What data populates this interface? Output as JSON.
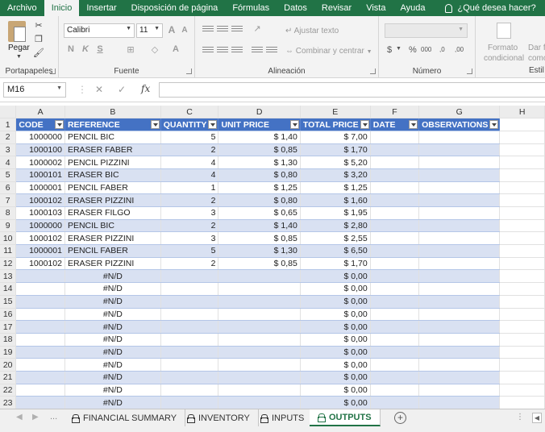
{
  "menu": {
    "items": [
      {
        "label": "Archivo",
        "active": false
      },
      {
        "label": "Inicio",
        "active": true
      },
      {
        "label": "Insertar",
        "active": false
      },
      {
        "label": "Disposición de página",
        "active": false
      },
      {
        "label": "Fórmulas",
        "active": false
      },
      {
        "label": "Datos",
        "active": false
      },
      {
        "label": "Revisar",
        "active": false
      },
      {
        "label": "Vista",
        "active": false
      },
      {
        "label": "Ayuda",
        "active": false
      }
    ],
    "tell_me": "¿Qué desea hacer?"
  },
  "ribbon": {
    "clipboard": {
      "paste_label": "Pegar",
      "group_label": "Portapapeles"
    },
    "font": {
      "font_name": "Calibri",
      "font_size": "11",
      "group_label": "Fuente",
      "bold": "N",
      "italic": "K",
      "underline": "S",
      "grow": "A",
      "shrink": "A",
      "font_color": "A"
    },
    "alignment": {
      "wrap_text": "Ajustar texto",
      "merge_center": "Combinar y centrar",
      "group_label": "Alineación"
    },
    "number": {
      "group_label": "Número",
      "currency": "$",
      "percent": "%",
      "thousands": "000",
      "inc_decimals": ",0",
      "dec_decimals": ",00"
    },
    "styles": {
      "cond_format_line1": "Formato",
      "cond_format_line2": "condicional",
      "format_table_line1": "Dar f",
      "format_table_line2": "como",
      "group_label": "Estil"
    }
  },
  "formula_bar": {
    "name_box": "M16",
    "cancel": "✕",
    "enter": "✓",
    "fx": "fx",
    "content": ""
  },
  "columns": [
    "A",
    "B",
    "C",
    "D",
    "E",
    "F",
    "G",
    "H"
  ],
  "table": {
    "headers": [
      "CODE",
      "REFERENCE",
      "QUANTITY",
      "UNIT PRICE",
      "TOTAL PRICE",
      "DATE",
      "OBSERVATIONS"
    ],
    "rows": [
      {
        "n": "2",
        "code": "1000000",
        "ref": "PENCIL BIC",
        "qty": "5",
        "unit": "$ 1,40",
        "total": "$ 7,00"
      },
      {
        "n": "3",
        "code": "1000100",
        "ref": "ERASER FABER",
        "qty": "2",
        "unit": "$ 0,85",
        "total": "$ 1,70"
      },
      {
        "n": "4",
        "code": "1000002",
        "ref": "PENCIL PIZZINI",
        "qty": "4",
        "unit": "$ 1,30",
        "total": "$ 5,20"
      },
      {
        "n": "5",
        "code": "1000101",
        "ref": "ERASER BIC",
        "qty": "4",
        "unit": "$ 0,80",
        "total": "$ 3,20"
      },
      {
        "n": "6",
        "code": "1000001",
        "ref": "PENCIL FABER",
        "qty": "1",
        "unit": "$ 1,25",
        "total": "$ 1,25"
      },
      {
        "n": "7",
        "code": "1000102",
        "ref": "ERASER PIZZINI",
        "qty": "2",
        "unit": "$ 0,80",
        "total": "$ 1,60"
      },
      {
        "n": "8",
        "code": "1000103",
        "ref": "ERASER FILGO",
        "qty": "3",
        "unit": "$ 0,65",
        "total": "$ 1,95"
      },
      {
        "n": "9",
        "code": "1000000",
        "ref": "PENCIL BIC",
        "qty": "2",
        "unit": "$ 1,40",
        "total": "$ 2,80"
      },
      {
        "n": "10",
        "code": "1000102",
        "ref": "ERASER PIZZINI",
        "qty": "3",
        "unit": "$ 0,85",
        "total": "$ 2,55"
      },
      {
        "n": "11",
        "code": "1000001",
        "ref": "PENCIL FABER",
        "qty": "5",
        "unit": "$ 1,30",
        "total": "$ 6,50"
      },
      {
        "n": "12",
        "code": "1000102",
        "ref": "ERASER PIZZINI",
        "qty": "2",
        "unit": "$ 0,85",
        "total": "$ 1,70"
      },
      {
        "n": "13",
        "code": "",
        "ref": "#N/D",
        "qty": "",
        "unit": "",
        "total": "$ 0,00"
      },
      {
        "n": "14",
        "code": "",
        "ref": "#N/D",
        "qty": "",
        "unit": "",
        "total": "$ 0,00"
      },
      {
        "n": "15",
        "code": "",
        "ref": "#N/D",
        "qty": "",
        "unit": "",
        "total": "$ 0,00"
      },
      {
        "n": "16",
        "code": "",
        "ref": "#N/D",
        "qty": "",
        "unit": "",
        "total": "$ 0,00"
      },
      {
        "n": "17",
        "code": "",
        "ref": "#N/D",
        "qty": "",
        "unit": "",
        "total": "$ 0,00"
      },
      {
        "n": "18",
        "code": "",
        "ref": "#N/D",
        "qty": "",
        "unit": "",
        "total": "$ 0,00"
      },
      {
        "n": "19",
        "code": "",
        "ref": "#N/D",
        "qty": "",
        "unit": "",
        "total": "$ 0,00"
      },
      {
        "n": "20",
        "code": "",
        "ref": "#N/D",
        "qty": "",
        "unit": "",
        "total": "$ 0,00"
      },
      {
        "n": "21",
        "code": "",
        "ref": "#N/D",
        "qty": "",
        "unit": "",
        "total": "$ 0,00"
      },
      {
        "n": "22",
        "code": "",
        "ref": "#N/D",
        "qty": "",
        "unit": "",
        "total": "$ 0,00"
      },
      {
        "n": "23",
        "code": "",
        "ref": "#N/D",
        "qty": "",
        "unit": "",
        "total": "$ 0,00"
      }
    ]
  },
  "sheet_tabs": [
    {
      "label": "FINANCIAL SUMMARY",
      "active": false
    },
    {
      "label": "INVENTORY",
      "active": false
    },
    {
      "label": "INPUTS",
      "active": false
    },
    {
      "label": "OUTPUTS",
      "active": true
    }
  ],
  "tab_bar": {
    "dots": "...",
    "add": "+",
    "scroll_dots": "⋮",
    "scroll_left": "◀"
  },
  "colors": {
    "accent": "#217346",
    "table_header": "#4472c4",
    "table_band": "#d9e1f2"
  }
}
